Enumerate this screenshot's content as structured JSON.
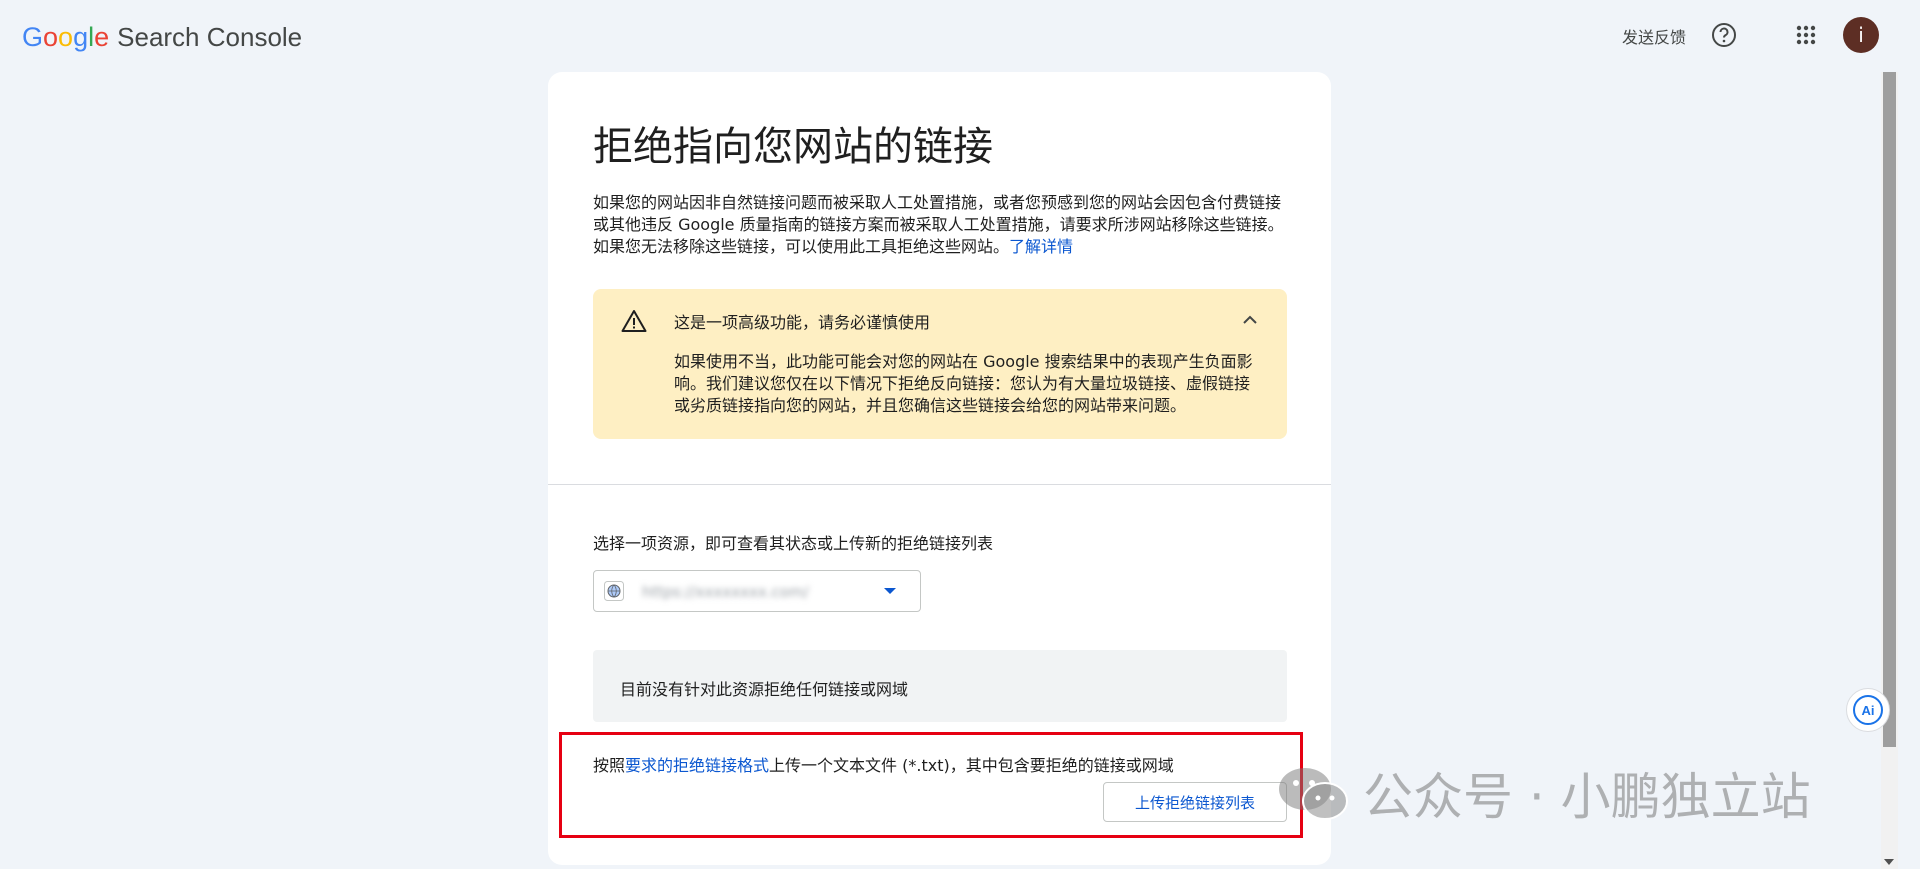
{
  "header": {
    "logo_letters": [
      "G",
      "o",
      "o",
      "g",
      "l",
      "e"
    ],
    "product_name": "Search Console",
    "feedback_label": "发送反馈",
    "avatar_initial": "i",
    "icons": [
      "help-icon",
      "apps-grid-icon"
    ]
  },
  "card": {
    "title": "拒绝指向您网站的链接",
    "intro_text": "如果您的网站因非自然链接问题而被采取人工处置措施，或者您预感到您的网站会因包含付费链接或其他违反 Google 质量指南的链接方案而被采取人工处置措施，请要求所涉网站移除这些链接。如果您无法移除这些链接，可以使用此工具拒绝这些网站。",
    "learn_more": "了解详情",
    "warning": {
      "title": "这是一项高级功能，请务必谨慎使用",
      "body": "如果使用不当，此功能可能会对您的网站在 Google 搜索结果中的表现产生负面影响。我们建议您仅在以下情况下拒绝反向链接：您认为有大量垃圾链接、虚假链接或劣质链接指向您的网站，并且您确信这些链接会给您的网站带来问题。",
      "icons": [
        "warning-icon",
        "chevron-up-icon"
      ]
    },
    "select_label": "选择一项资源，即可查看其状态或上传新的拒绝链接列表",
    "resource_value": "https://xxxxxxxx.com/",
    "empty_message": "目前没有针对此资源拒绝任何链接或网域",
    "upload": {
      "prefix": "按照",
      "link": "要求的拒绝链接格式",
      "suffix": "上传一个文本文件 (*.txt)，其中包含要拒绝的链接或网域",
      "button_label": "上传拒绝链接列表"
    }
  },
  "overlay": {
    "watermark": "公众号 · 小鹏独立站",
    "ai_badge": "Ai"
  },
  "colors": {
    "background": "#f0f4f9",
    "link": "#0b57d0",
    "warning_bg": "#feefc3",
    "highlight_border": "#e60012"
  }
}
